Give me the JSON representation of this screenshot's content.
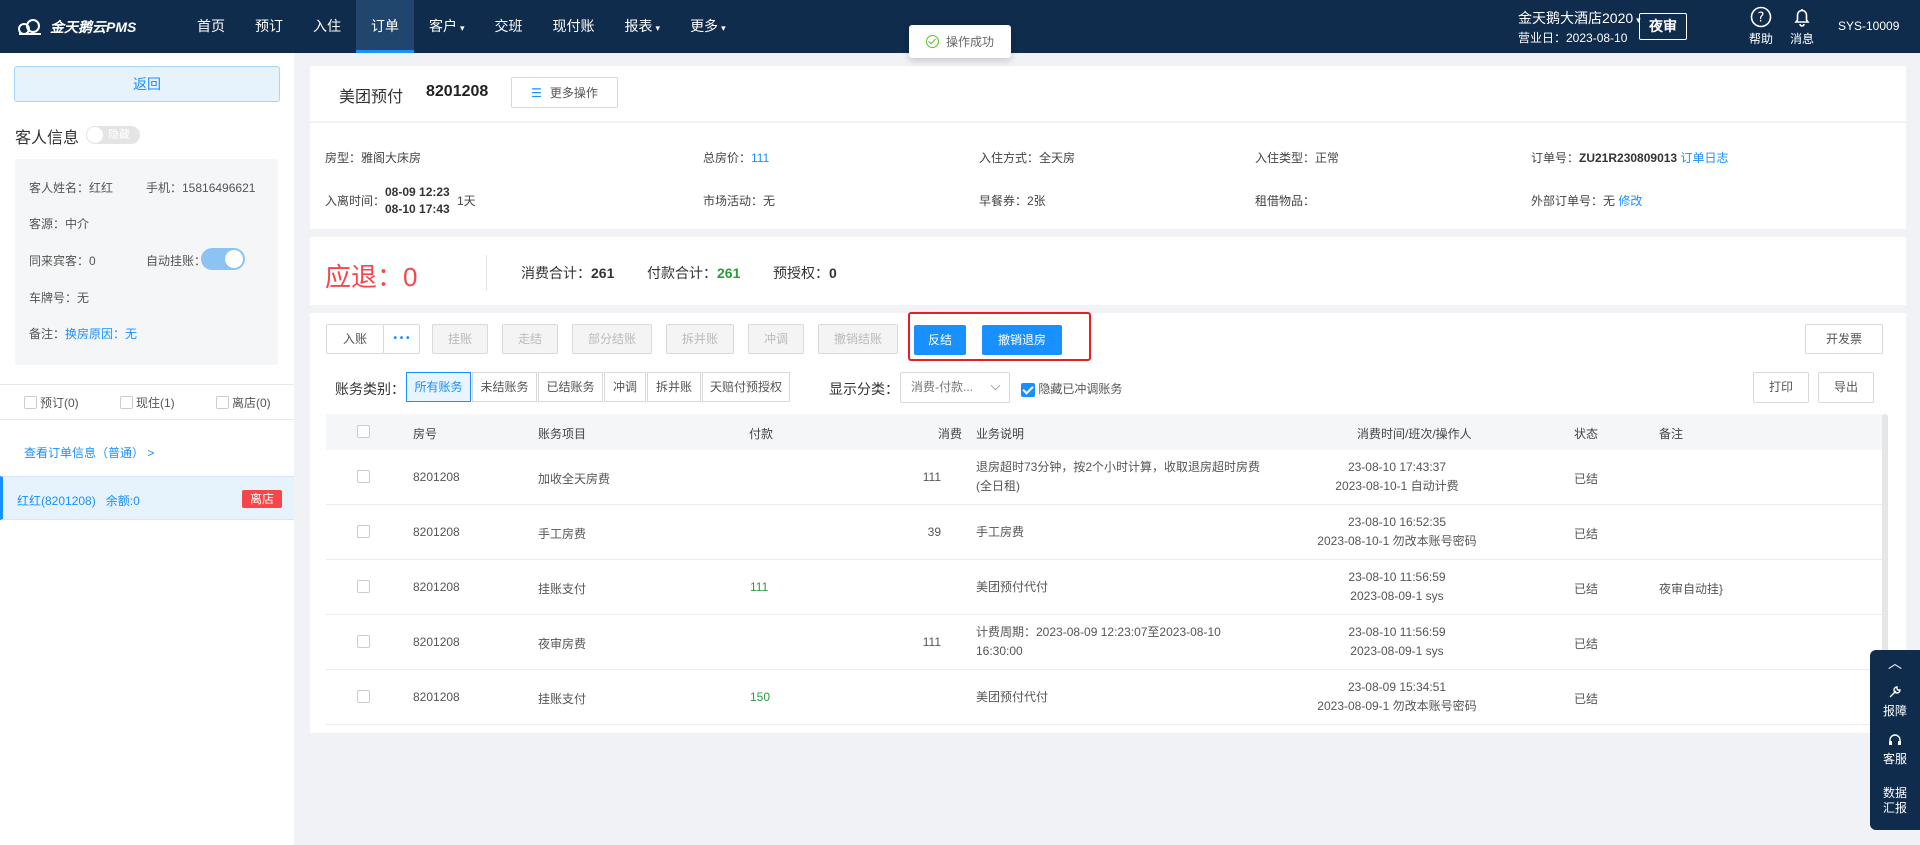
{
  "app": {
    "logo": "金天鹅云PMS"
  },
  "nav": [
    {
      "label": "首页",
      "caret": false
    },
    {
      "label": "预订",
      "caret": false
    },
    {
      "label": "入住",
      "caret": false
    },
    {
      "label": "订单",
      "caret": false,
      "active": true
    },
    {
      "label": "客户",
      "caret": true
    },
    {
      "label": "交班",
      "caret": false
    },
    {
      "label": "现付账",
      "caret": false
    },
    {
      "label": "报表",
      "caret": true
    },
    {
      "label": "更多",
      "caret": true
    }
  ],
  "header": {
    "hotel": "金天鹅大酒店2020",
    "business_date": "营业日：2023-08-10",
    "night_audit": "夜审",
    "help": "帮助",
    "messages": "消息",
    "user": "SYS-10009"
  },
  "toast": "操作成功",
  "sidebar": {
    "back": "返回",
    "guest_title": "客人信息",
    "hide_toggle": "隐藏",
    "guest_name": "客人姓名：红红",
    "phone": "手机：15816496621",
    "source": "客源：中介",
    "companions": "同来宾客：0",
    "auto_hang": "自动挂账：",
    "plate": "车牌号：无",
    "remark_label": "备注：",
    "remark_value": "换房原因：无",
    "status": [
      {
        "label": "预订(0)"
      },
      {
        "label": "现住(1)"
      },
      {
        "label": "离店(0)"
      }
    ],
    "order_link": "查看订单信息（普通） >",
    "room_item": "红红(8201208)",
    "balance": "余额:0",
    "room_tag": "离店"
  },
  "order": {
    "channel": "美团预付",
    "number": "8201208",
    "more_ops": "更多操作",
    "room_type_label": "房型：",
    "room_type": "雅阁大床房",
    "total_label": "总房价：",
    "total": "111",
    "checkin_mode": "入住方式：全天房",
    "checkin_type": "入住类型：正常",
    "order_no_label": "订单号：",
    "order_no": "ZU21R230809013",
    "order_log": "订单日志",
    "stay_label": "入离时间：",
    "stay_in": "08-09 12:23",
    "stay_out": "08-10 17:43",
    "nights": "1天",
    "market": "市场活动：无",
    "breakfast": "早餐券：2张",
    "rental": "租借物品：",
    "ext_order_label": "外部订单号：无",
    "ext_order_edit": "修改"
  },
  "summary": {
    "due_label": "应退：",
    "due_value": "0",
    "consume_label": "消费合计：",
    "consume": "261",
    "pay_label": "付款合计：",
    "pay": "261",
    "preauth_label": "预授权：",
    "preauth": "0"
  },
  "actions": {
    "post": "入账",
    "more": "• • •",
    "hang": "挂账",
    "settle": "走结",
    "partial": "部分结账",
    "split": "拆并账",
    "adjust": "冲调",
    "cancel_settle": "撤销结账",
    "reverse": "反结",
    "undo_checkout": "撤销退房",
    "invoice": "开发票"
  },
  "filters": {
    "category_label": "账务类别：",
    "categories": [
      "所有账务",
      "未结账务",
      "已结账务",
      "冲调",
      "拆并账",
      "天赔付预授权"
    ],
    "display_label": "显示分类：",
    "display_value": "消费-付款...",
    "hide_adjust": "隐藏已冲调账务",
    "print": "打印",
    "export": "导出"
  },
  "table": {
    "headers": {
      "room": "房号",
      "item": "账务项目",
      "pay": "付款",
      "consume": "消费",
      "desc": "业务说明",
      "time": "消费时间/班次/操作人",
      "status": "状态",
      "remark": "备注"
    },
    "rows": [
      {
        "room": "8201208",
        "item": "加收全天房费",
        "pay": "",
        "consume": "111",
        "desc": "退房超时73分钟，按2个小时计算，收取退房超时房费(全日租)",
        "time1": "23-08-10 17:43:37",
        "time2": "2023-08-10-1 自动计费",
        "status": "已结",
        "remark": ""
      },
      {
        "room": "8201208",
        "item": "手工房费",
        "pay": "",
        "consume": "39",
        "desc": "手工房费",
        "time1": "23-08-10 16:52:35",
        "time2": "2023-08-10-1 勿改本账号密码",
        "status": "已结",
        "remark": ""
      },
      {
        "room": "8201208",
        "item": "挂账支付",
        "pay": "111",
        "consume": "",
        "desc": "美团预付代付",
        "time1": "23-08-10 11:56:59",
        "time2": "2023-08-09-1 sys",
        "status": "已结",
        "remark": "夜审自动挂}"
      },
      {
        "room": "8201208",
        "item": "夜审房费",
        "pay": "",
        "consume": "111",
        "desc": "计费周期：2023-08-09 12:23:07至2023-08-10 16:30:00",
        "time1": "23-08-10 11:56:59",
        "time2": "2023-08-09-1 sys",
        "status": "已结",
        "remark": ""
      },
      {
        "room": "8201208",
        "item": "挂账支付",
        "pay": "150",
        "consume": "",
        "desc": "美团预付代付",
        "time1": "23-08-09 15:34:51",
        "time2": "2023-08-09-1 勿改本账号密码",
        "status": "已结",
        "remark": ""
      }
    ]
  },
  "float": {
    "report": "报障",
    "service": "客服",
    "data1": "数据",
    "data2": "汇报"
  }
}
